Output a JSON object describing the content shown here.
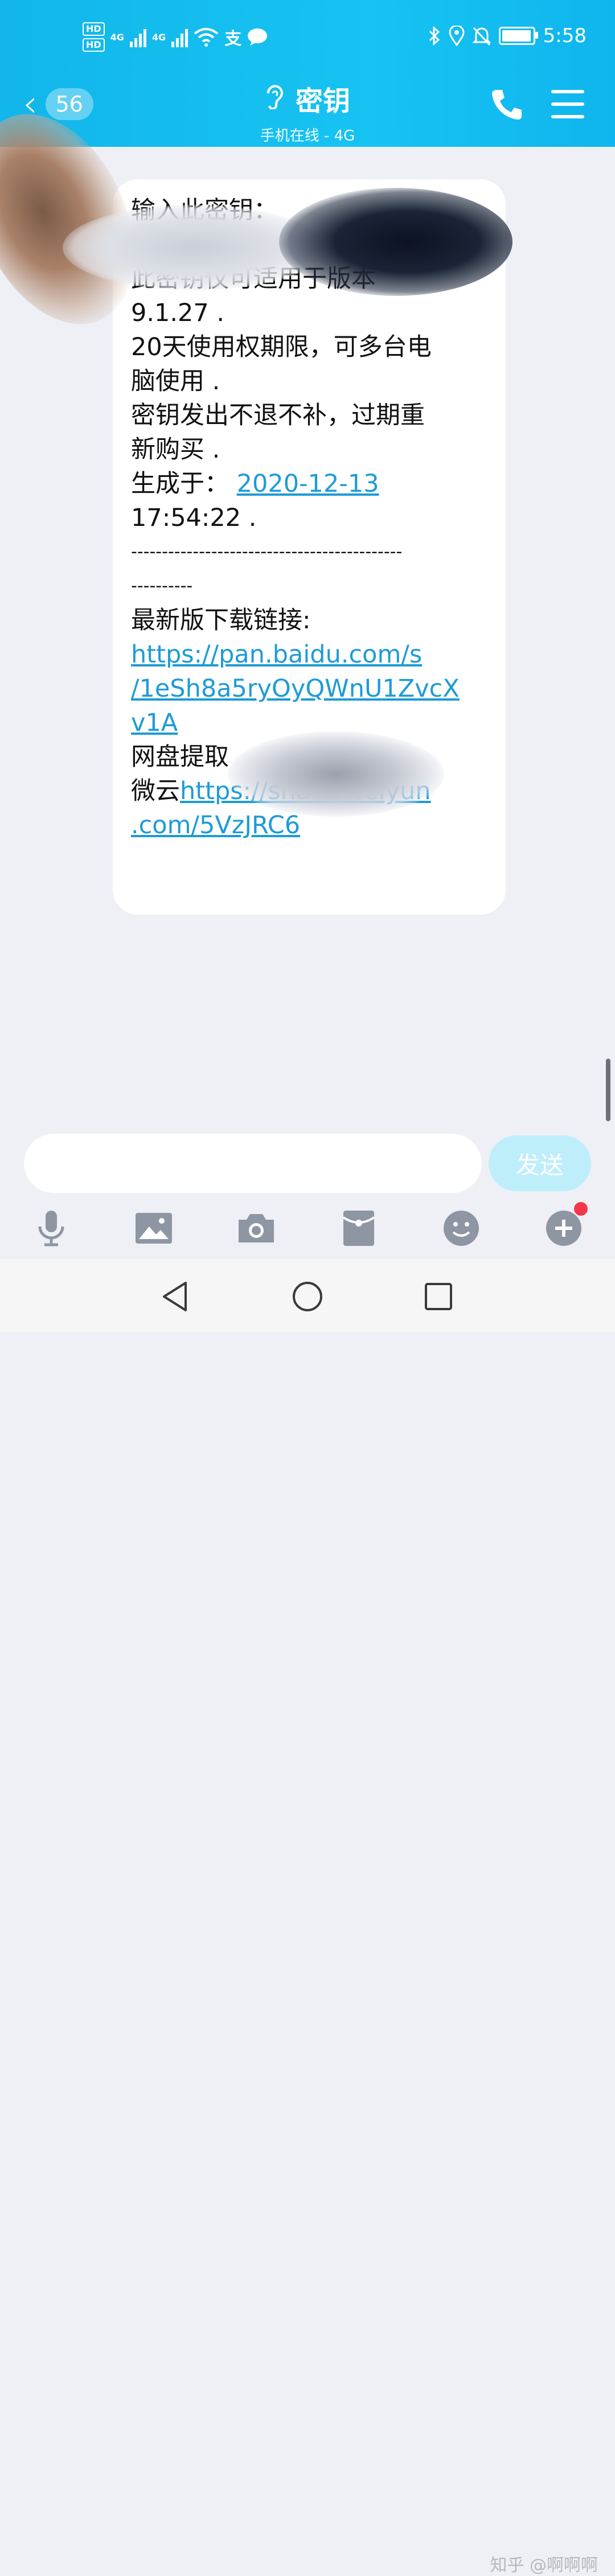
{
  "status_bar": {
    "hd1": "HD",
    "hd2": "HD",
    "net1": "4G",
    "net2": "4G",
    "time": "5:58"
  },
  "header": {
    "unread_count": "56",
    "title": "密钥",
    "subtitle": "手机在线 - 4G"
  },
  "message": {
    "lines": [
      "输入此密钥：",
      "此密钥仅可适用于版本",
      "9.1.27 .",
      "20天使用权期限，可多台电",
      "脑使用 .",
      "密钥发出不退不补，过期重",
      "新购买 .",
      "17:54:22 .",
      "--------------------------------------------",
      "----------",
      "最新版下载链接:",
      "网盘提取",
      "微云"
    ],
    "generated_prefix": "生成于：",
    "generated_date": "2020-12-13",
    "download_link_lines": [
      "https://pan.baidu.com/s",
      "/1eSh8a5ryOyQWnU1ZvcX",
      "v1A"
    ],
    "weiyun_link_lines": [
      "https://share.weiyun",
      ".com/5VzJRC6"
    ]
  },
  "input": {
    "send_label": "发送"
  },
  "toolbar": {
    "icons": [
      "microphone-icon",
      "image-icon",
      "camera-icon",
      "red-packet-icon",
      "emoji-icon",
      "plus-icon"
    ]
  },
  "watermark": "知乎 @啊啊啊",
  "colors": {
    "header": "#16c3f2",
    "link": "#1d9bd7",
    "send_button": "#bfeefb",
    "background": "#eef0f6"
  }
}
